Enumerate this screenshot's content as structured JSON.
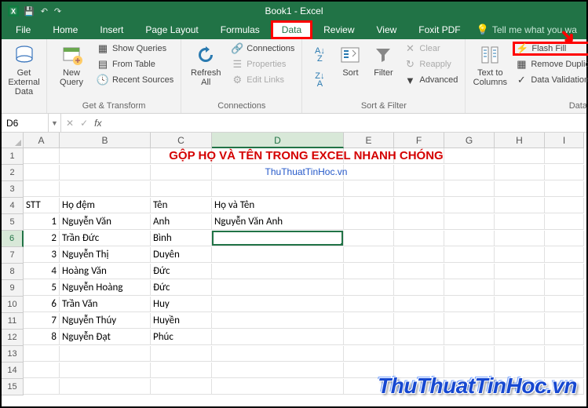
{
  "title": "Book1 - Excel",
  "tabs": [
    "File",
    "Home",
    "Insert",
    "Page Layout",
    "Formulas",
    "Data",
    "Review",
    "View",
    "Foxit PDF"
  ],
  "active_tab": "Data",
  "tellme": "Tell me what you wa",
  "ribbon": {
    "get_external": {
      "label": "Get External\nData",
      "group": ""
    },
    "get_transform": {
      "new_query": "New\nQuery",
      "show_queries": "Show Queries",
      "from_table": "From Table",
      "recent": "Recent Sources",
      "group": "Get & Transform"
    },
    "connections": {
      "refresh": "Refresh\nAll",
      "connections": "Connections",
      "properties": "Properties",
      "edit_links": "Edit Links",
      "group": "Connections"
    },
    "sort_filter": {
      "sort": "Sort",
      "filter": "Filter",
      "clear": "Clear",
      "reapply": "Reapply",
      "advanced": "Advanced",
      "group": "Sort & Filter"
    },
    "data_tools": {
      "text_to_columns": "Text to\nColumns",
      "flash_fill": "Flash Fill",
      "remove_dup": "Remove Duplic",
      "data_validation": "Data Validation",
      "group": "Data"
    }
  },
  "namebox": "D6",
  "formula": "",
  "columns": [
    "A",
    "B",
    "C",
    "D",
    "E",
    "F",
    "G",
    "H",
    "I"
  ],
  "active_col": "D",
  "active_row": 6,
  "row_count": 15,
  "sheet": {
    "title": "GỘP HỌ VÀ TÊN TRONG EXCEL NHANH CHÓNG",
    "subtitle": "ThuThuatTinHoc.vn",
    "headers": {
      "A": "STT",
      "B": "Họ đệm",
      "C": "Tên",
      "D": "Họ và Tên"
    },
    "rows": [
      {
        "stt": 1,
        "ho": "Nguyễn Văn",
        "ten": "Anh",
        "full": "Nguyễn Văn Anh"
      },
      {
        "stt": 2,
        "ho": "Trần Đức",
        "ten": "Bình",
        "full": ""
      },
      {
        "stt": 3,
        "ho": "Nguyễn Thị",
        "ten": "Duyên",
        "full": ""
      },
      {
        "stt": 4,
        "ho": "Hoàng Văn",
        "ten": "Đức",
        "full": ""
      },
      {
        "stt": 5,
        "ho": "Nguyễn Hoàng",
        "ten": "Đức",
        "full": ""
      },
      {
        "stt": 6,
        "ho": "Trần Văn",
        "ten": "Huy",
        "full": ""
      },
      {
        "stt": 7,
        "ho": "Nguyễn Thúy",
        "ten": "Huyền",
        "full": ""
      },
      {
        "stt": 8,
        "ho": "Nguyễn Đạt",
        "ten": "Phúc",
        "full": ""
      }
    ]
  },
  "watermark": "ThuThuatTinHoc",
  "watermark_tld": ".vn"
}
